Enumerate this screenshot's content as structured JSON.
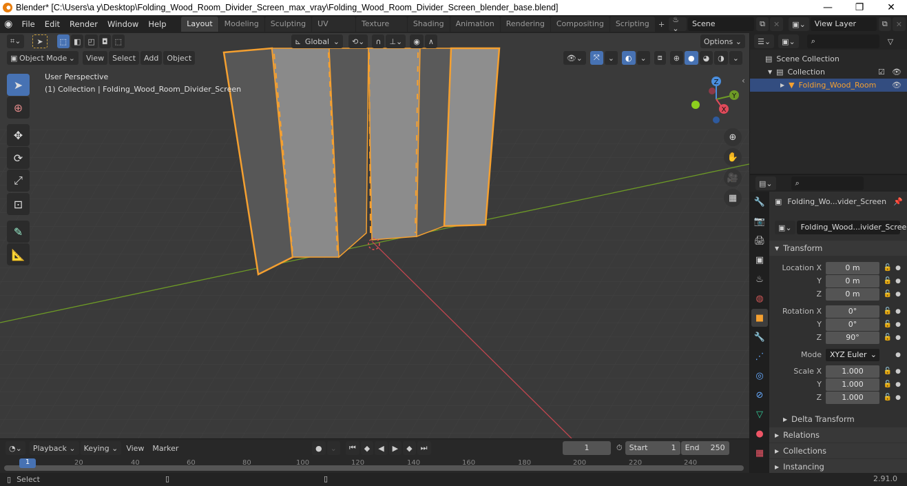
{
  "titlebar": {
    "title": "Blender* [C:\\Users\\a y\\Desktop\\Folding_Wood_Room_Divider_Screen_max_vray\\Folding_Wood_Room_Divider_Screen_blender_base.blend]",
    "minimize": "—",
    "maximize": "❐",
    "close": "✕"
  },
  "menubar": {
    "items": [
      "File",
      "Edit",
      "Render",
      "Window",
      "Help"
    ],
    "tabs": [
      "Layout",
      "Modeling",
      "Sculpting",
      "UV Editing",
      "Texture Paint",
      "Shading",
      "Animation",
      "Rendering",
      "Compositing",
      "Scripting"
    ],
    "active_tab": "Layout",
    "add_tab": "+",
    "scene": "Scene",
    "view_layer": "View Layer"
  },
  "viewport": {
    "header": {
      "transform_orientation": "Global",
      "options_label": "Options",
      "mode": "Object Mode",
      "menus": [
        "View",
        "Select",
        "Add",
        "Object"
      ]
    },
    "overlay_text": {
      "view_name": "User Perspective",
      "collection_info": "(1) Collection | Folding_Wood_Room_Divider_Screen"
    },
    "gizmo": {
      "z": "Z",
      "y": "Y",
      "x": "X"
    },
    "colors": {
      "selection_outline": "#f5a030",
      "x_axis": "#c0464f",
      "y_axis": "#6d9a26",
      "active_blue": "#4772b3"
    }
  },
  "outliner": {
    "search_placeholder": "",
    "rows": [
      {
        "label": "Scene Collection"
      },
      {
        "label": "Collection"
      },
      {
        "label": "Folding_Wood_Room"
      }
    ]
  },
  "properties": {
    "search_placeholder": "",
    "object_name": "Folding_Wo...vider_Screen",
    "data_name": "Folding_Wood...ivider_Screen",
    "transform_label": "Transform",
    "location": {
      "label": "Location X",
      "x": "0 m",
      "y": "0 m",
      "z": "0 m"
    },
    "rotation": {
      "label": "Rotation X",
      "x": "0°",
      "y": "0°",
      "z": "90°"
    },
    "mode": {
      "label": "Mode",
      "value": "XYZ Euler"
    },
    "scale": {
      "label": "Scale X",
      "x": "1.000",
      "y": "1.000",
      "z": "1.000"
    },
    "axis_y": "Y",
    "axis_z": "Z",
    "delta_transform": "Delta Transform",
    "relations": "Relations",
    "collections": "Collections",
    "instancing": "Instancing"
  },
  "timeline": {
    "menus": [
      "Playback",
      "Keying",
      "View",
      "Marker"
    ],
    "current_frame": "1",
    "start_label": "Start",
    "start": "1",
    "end_label": "End",
    "end": "250",
    "ticks": [
      "1",
      "20",
      "40",
      "60",
      "80",
      "100",
      "120",
      "140",
      "160",
      "180",
      "200",
      "220",
      "240"
    ]
  },
  "statusbar": {
    "select_label": "Select",
    "version": "2.91.0"
  }
}
